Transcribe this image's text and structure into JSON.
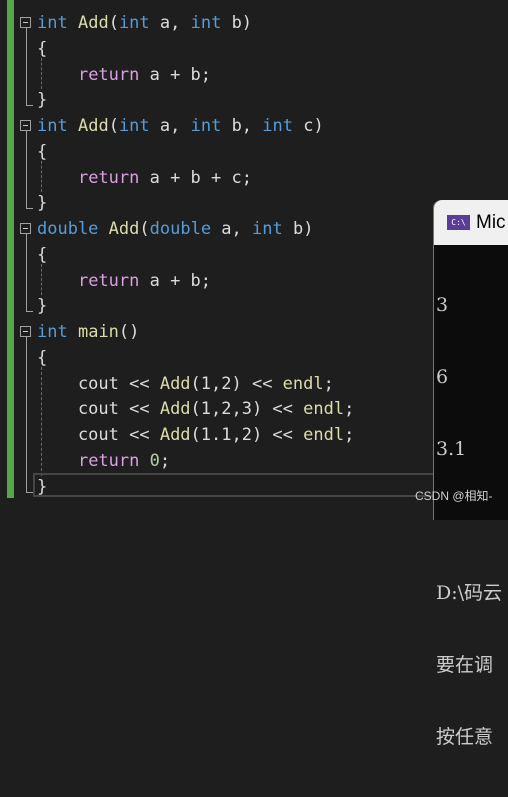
{
  "editor": {
    "lines": [
      [
        [
          "int",
          "kw"
        ],
        [
          " ",
          "tx"
        ],
        [
          "Add",
          "fn"
        ],
        [
          "(",
          "tx"
        ],
        [
          "int",
          "kw"
        ],
        [
          " a, ",
          "tx"
        ],
        [
          "int",
          "kw"
        ],
        [
          " b)",
          "tx"
        ]
      ],
      [
        [
          "{",
          "tx"
        ]
      ],
      [
        [
          "    ",
          "tx"
        ],
        [
          "return",
          "ctl"
        ],
        [
          " a + b;",
          "tx"
        ]
      ],
      [
        [
          "}",
          "tx"
        ]
      ],
      [
        [
          "int",
          "kw"
        ],
        [
          " ",
          "tx"
        ],
        [
          "Add",
          "fn"
        ],
        [
          "(",
          "tx"
        ],
        [
          "int",
          "kw"
        ],
        [
          " a, ",
          "tx"
        ],
        [
          "int",
          "kw"
        ],
        [
          " b, ",
          "tx"
        ],
        [
          "int",
          "kw"
        ],
        [
          " c)",
          "tx"
        ]
      ],
      [
        [
          "{",
          "tx"
        ]
      ],
      [
        [
          "    ",
          "tx"
        ],
        [
          "return",
          "ctl"
        ],
        [
          " a + b + c;",
          "tx"
        ]
      ],
      [
        [
          "}",
          "tx"
        ]
      ],
      [
        [
          "double",
          "kw"
        ],
        [
          " ",
          "tx"
        ],
        [
          "Add",
          "fn"
        ],
        [
          "(",
          "tx"
        ],
        [
          "double",
          "kw"
        ],
        [
          " a, ",
          "tx"
        ],
        [
          "int",
          "kw"
        ],
        [
          " b)",
          "tx"
        ]
      ],
      [
        [
          "{",
          "tx"
        ]
      ],
      [
        [
          "    ",
          "tx"
        ],
        [
          "return",
          "ctl"
        ],
        [
          " a + b;",
          "tx"
        ]
      ],
      [
        [
          "}",
          "tx"
        ]
      ],
      [
        [
          "int",
          "kw"
        ],
        [
          " ",
          "tx"
        ],
        [
          "main",
          "fn"
        ],
        [
          "()",
          "tx"
        ]
      ],
      [
        [
          "{",
          "tx"
        ]
      ],
      [
        [
          "    cout << ",
          "tx"
        ],
        [
          "Add",
          "fn"
        ],
        [
          "(1,2) << ",
          "tx"
        ],
        [
          "endl",
          "fn"
        ],
        [
          ";",
          "tx"
        ]
      ],
      [
        [
          "    cout << ",
          "tx"
        ],
        [
          "Add",
          "fn"
        ],
        [
          "(1,2,3) << ",
          "tx"
        ],
        [
          "endl",
          "fn"
        ],
        [
          ";",
          "tx"
        ]
      ],
      [
        [
          "    cout << ",
          "tx"
        ],
        [
          "Add",
          "fn"
        ],
        [
          "(1.1,2) << ",
          "tx"
        ],
        [
          "endl",
          "fn"
        ],
        [
          ";",
          "tx"
        ]
      ],
      [
        [
          "    ",
          "tx"
        ],
        [
          "return",
          "ctl"
        ],
        [
          " ",
          "tx"
        ],
        [
          "0",
          "num"
        ],
        [
          ";",
          "tx"
        ]
      ],
      [
        [
          "}",
          "tx"
        ]
      ]
    ]
  },
  "console": {
    "title": "Mic",
    "icon": "C:\\",
    "output": [
      "3",
      "6",
      "3.1",
      "",
      "D:\\码云",
      "要在调",
      "按任意"
    ]
  },
  "watermark": "CSDN @相知-"
}
